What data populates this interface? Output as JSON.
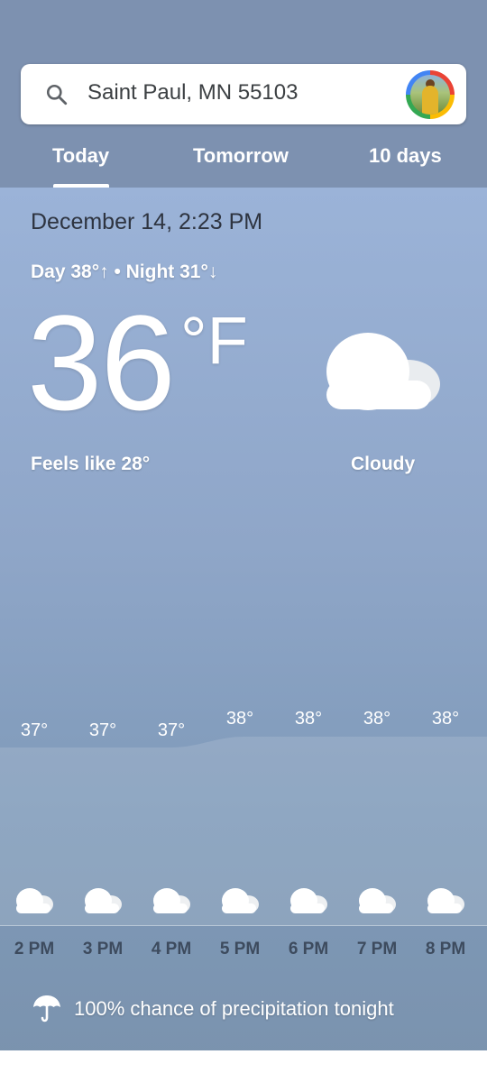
{
  "search": {
    "location": "Saint Paul, MN 55103"
  },
  "tabs": [
    {
      "label": "Today",
      "selected": true
    },
    {
      "label": "Tomorrow",
      "selected": false
    },
    {
      "label": "10 days",
      "selected": false
    }
  ],
  "current": {
    "datetime": "December 14, 2:23 PM",
    "day_night": "Day 38°↑ • Night 31°↓",
    "temperature": "36",
    "unit": "°F",
    "feels_like": "Feels like 28°",
    "condition": "Cloudy",
    "condition_icon": "cloud-icon"
  },
  "hourly": [
    {
      "time": "2 PM",
      "temp": "37°",
      "icon": "cloud-icon"
    },
    {
      "time": "3 PM",
      "temp": "37°",
      "icon": "cloud-icon"
    },
    {
      "time": "4 PM",
      "temp": "37°",
      "icon": "cloud-icon"
    },
    {
      "time": "5 PM",
      "temp": "38°",
      "icon": "cloud-icon"
    },
    {
      "time": "6 PM",
      "temp": "38°",
      "icon": "cloud-icon"
    },
    {
      "time": "7 PM",
      "temp": "38°",
      "icon": "cloud-icon"
    },
    {
      "time": "8 PM",
      "temp": "38°",
      "icon": "cloud-icon"
    }
  ],
  "precipitation": {
    "text": "100% chance of precipitation tonight",
    "icon": "umbrella-icon"
  },
  "colors": {
    "header_bg": "#7d91b0",
    "sky_top": "#9bb3d8",
    "sky_bottom": "#7a92ad",
    "text_dark": "#2e3440"
  }
}
